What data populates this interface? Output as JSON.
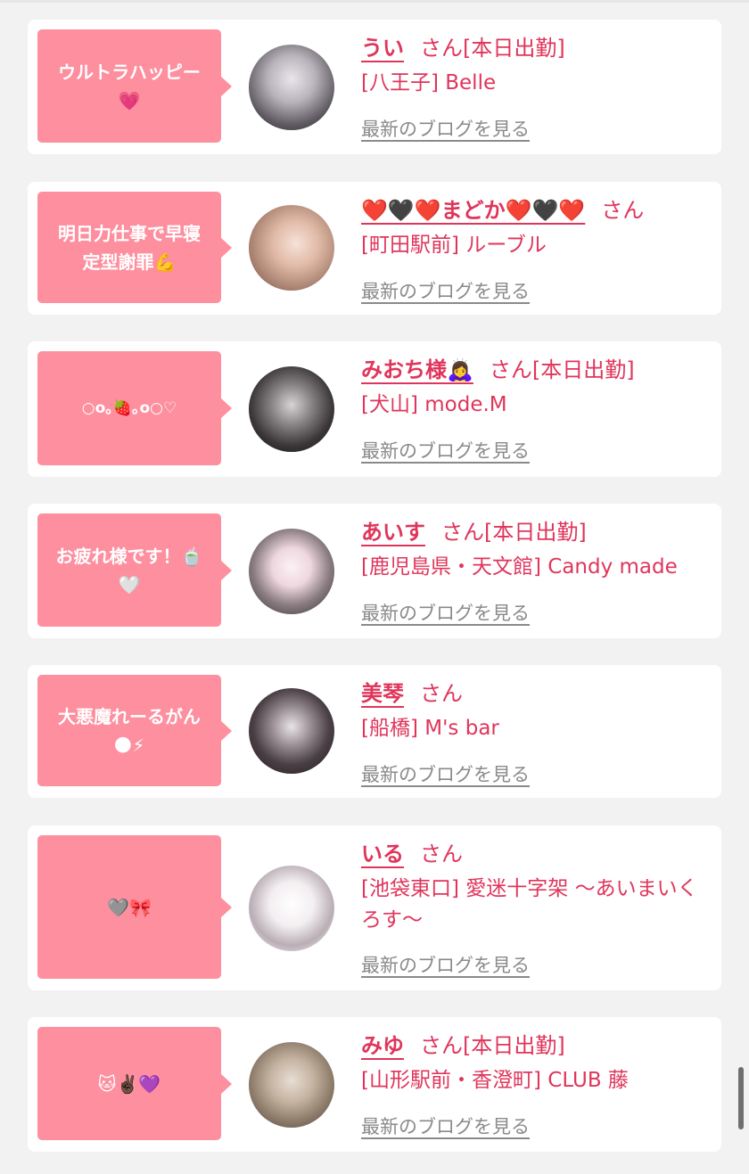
{
  "colors": {
    "page_background": "#f2f2f2",
    "card_background": "#ffffff",
    "bubble_pink": "#fd8f9f",
    "accent_red": "#e0355b",
    "link_gray": "#8a8a8a"
  },
  "cards": [
    {
      "message": "ウルトラハッピー\n💗",
      "avatar_icon": "girl-photo-avatar",
      "name": "うい",
      "suffix": "さん[本日出勤]",
      "shop": "[八王子] Belle",
      "blog_link": "最新のブログを見る"
    },
    {
      "message": "明日力仕事で早寝\n定型謝罪💪",
      "avatar_icon": "girl-photo-avatar",
      "name": "❤️🖤❤️まどか❤️🖤❤️",
      "suffix": "さん",
      "shop": "[町田駅前] ルーブル",
      "blog_link": "最新のブログを見る"
    },
    {
      "message": "○o｡🍓｡o○♡",
      "avatar_icon": "girl-photo-avatar",
      "name": "みおち様🙇‍♀️",
      "suffix": "さん[本日出勤]",
      "shop": "[犬山] mode.M",
      "blog_link": "最新のブログを見る"
    },
    {
      "message": "お疲れ様です！🍵\n🤍",
      "avatar_icon": "girl-photo-avatar",
      "name": "あいす",
      "suffix": "さん[本日出勤]",
      "shop": "[鹿児島県・天文館] Candy made",
      "blog_link": "最新のブログを見る"
    },
    {
      "message": "大悪魔れーるがん\n🌑⚡",
      "avatar_icon": "girl-photo-avatar",
      "name": "美琴",
      "suffix": "さん",
      "shop": "[船橋] M's bar",
      "blog_link": "最新のブログを見る"
    },
    {
      "message": "🩶🎀",
      "avatar_icon": "girl-photo-avatar",
      "name": "いる",
      "suffix": "さん",
      "shop": "[池袋東口] 愛迷十字架 〜あいまいくろす〜",
      "blog_link": "最新のブログを見る"
    },
    {
      "message": "🐱✌🏿💜",
      "avatar_icon": "girl-photo-avatar",
      "name": "みゆ",
      "suffix": "さん[本日出勤]",
      "shop": "[山形駅前・香澄町] CLUB 藤",
      "blog_link": "最新のブログを見る"
    }
  ]
}
